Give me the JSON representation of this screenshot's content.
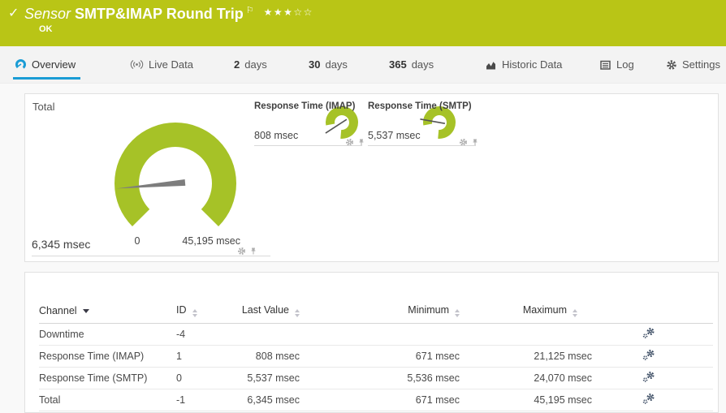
{
  "header": {
    "status_check": "✓",
    "kind": "Sensor",
    "title": "SMTP&IMAP Round Trip",
    "flag": "⚐",
    "stars": "★★★☆☆",
    "status": "OK"
  },
  "tabs": [
    {
      "label": "Overview"
    },
    {
      "label": "Live Data"
    },
    {
      "num": "2",
      "label": "days"
    },
    {
      "num": "30",
      "label": "days"
    },
    {
      "num": "365",
      "label": "days"
    },
    {
      "label": "Historic Data"
    },
    {
      "label": "Log"
    },
    {
      "label": "Settings"
    }
  ],
  "gauges": {
    "total": {
      "label": "Total",
      "value": "6,345 msec",
      "scale_min": "0",
      "scale_max": "45,195 msec"
    },
    "imap": {
      "label": "Response Time (IMAP)",
      "value": "808 msec"
    },
    "smtp": {
      "label": "Response Time (SMTP)",
      "value": "5,537 msec"
    }
  },
  "table": {
    "columns": {
      "channel": "Channel",
      "id": "ID",
      "last": "Last Value",
      "min": "Minimum",
      "max": "Maximum"
    },
    "rows": [
      {
        "channel": "Downtime",
        "id": "-4",
        "last": "",
        "min": "",
        "max": ""
      },
      {
        "channel": "Response Time (IMAP)",
        "id": "1",
        "last": "808 msec",
        "min": "671 msec",
        "max": "21,125 msec"
      },
      {
        "channel": "Response Time (SMTP)",
        "id": "0",
        "last": "5,537 msec",
        "min": "5,536 msec",
        "max": "24,070 msec"
      },
      {
        "channel": "Total",
        "id": "-1",
        "last": "6,345 msec",
        "min": "671 msec",
        "max": "45,195 msec"
      }
    ]
  },
  "colors": {
    "header_green": "#b9c516",
    "gauge_green": "#a6c227",
    "accent_blue": "#1a9cd5",
    "status_ok": "#b9c516"
  }
}
